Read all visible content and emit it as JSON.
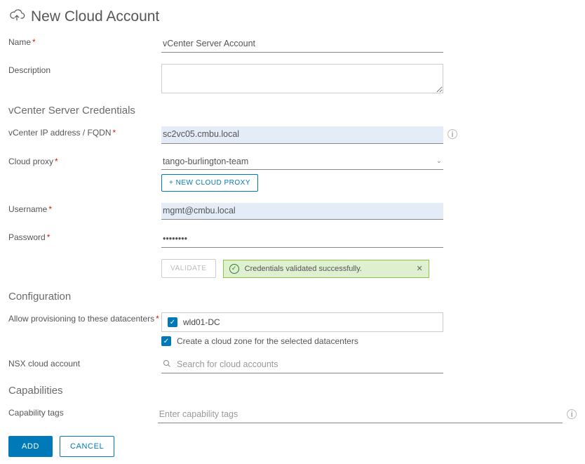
{
  "page": {
    "title": "New Cloud Account"
  },
  "fields": {
    "name": {
      "label": "Name",
      "value": "vCenter Server Account"
    },
    "description": {
      "label": "Description",
      "value": ""
    }
  },
  "sections": {
    "credentials": "vCenter Server Credentials",
    "configuration": "Configuration",
    "capabilities": "Capabilities"
  },
  "credentials": {
    "fqdn": {
      "label": "vCenter IP address / FQDN",
      "value": "sc2vc05.cmbu.local"
    },
    "proxy": {
      "label": "Cloud proxy",
      "value": "tango-burlington-team"
    },
    "newProxyBtn": "+ NEW CLOUD PROXY",
    "username": {
      "label": "Username",
      "value": "mgmt@cmbu.local"
    },
    "password": {
      "label": "Password",
      "value": "••••••••"
    },
    "validateBtn": "VALIDATE",
    "successMsg": "Credentials validated successfully."
  },
  "configuration": {
    "allowDc": {
      "label": "Allow provisioning to these datacenters",
      "item": "wld01-DC"
    },
    "createZone": "Create a cloud zone for the selected datacenters",
    "nsx": {
      "label": "NSX cloud account",
      "placeholder": "Search for cloud accounts"
    }
  },
  "capabilities": {
    "tags": {
      "label": "Capability tags",
      "placeholder": "Enter capability tags"
    }
  },
  "footer": {
    "add": "ADD",
    "cancel": "CANCEL"
  }
}
